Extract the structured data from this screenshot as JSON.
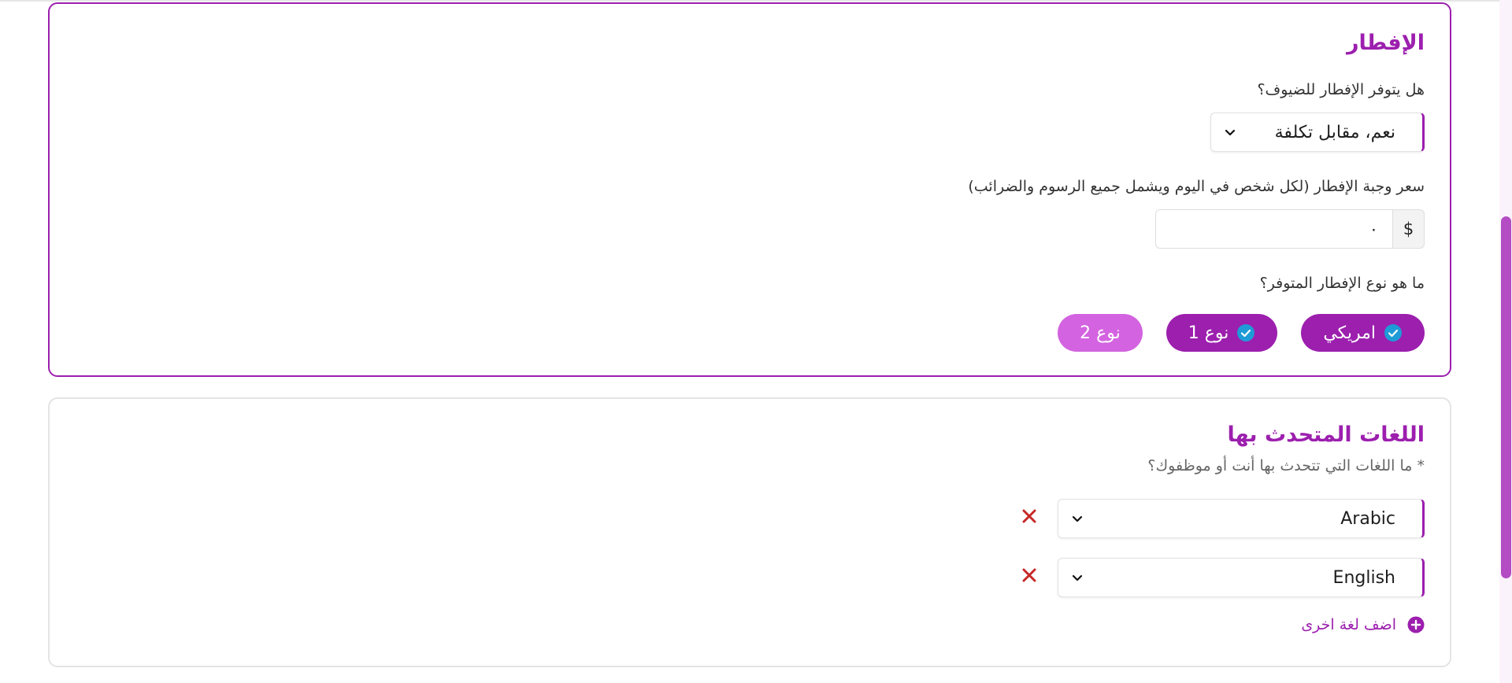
{
  "colors": {
    "accent": "#9c1fae",
    "chip_unselected": "#d363e0",
    "check_icon": "#1e9bd7",
    "remove_icon": "#c62828"
  },
  "breakfast": {
    "title": "الإفطار",
    "availability_label": "هل يتوفر الإفطار للضيوف؟",
    "availability_value": "نعم، مقابل تكلفة",
    "price_label": "سعر وجبة الإفطار (لكل شخص في اليوم ويشمل جميع الرسوم والضرائب)",
    "currency_symbol": "$",
    "price_value": "٠",
    "type_label": "ما هو نوع الإفطار المتوفر؟",
    "types": [
      {
        "label": "امريكي",
        "selected": true,
        "icon": "check-circle-icon"
      },
      {
        "label": "نوع 1",
        "selected": true,
        "icon": "check-circle-icon"
      },
      {
        "label": "نوع 2",
        "selected": false
      }
    ]
  },
  "languages": {
    "title": "اللغات المتحدث بها",
    "subtitle": "* ما اللغات التي تتحدث بها أنت أو موظفوك؟",
    "items": [
      {
        "value": "Arabic",
        "remove_icon": "close-icon"
      },
      {
        "value": "English",
        "remove_icon": "close-icon"
      }
    ],
    "add_label": "اضف لغة اخرى",
    "add_icon": "plus-circle-icon"
  }
}
